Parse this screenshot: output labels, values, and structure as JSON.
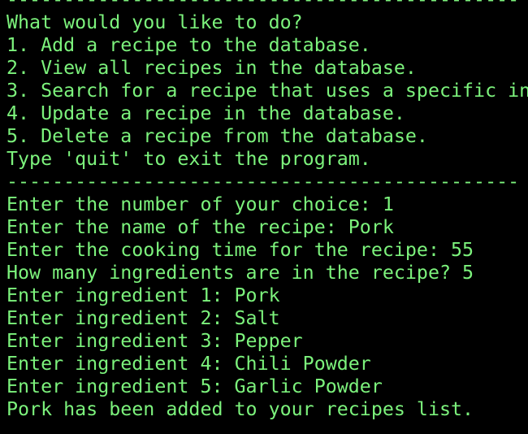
{
  "terminal": {
    "text_color": "#7CF27C",
    "background_color": "#000000",
    "separator_top": "---------------------------------------------",
    "menu": {
      "prompt": "What would you like to do?",
      "options": [
        "1. Add a recipe to the database.",
        "2. View all recipes in the database.",
        "3. Search for a recipe that uses a specific in",
        "4. Update a recipe in the database.",
        "5. Delete a recipe from the database."
      ],
      "quit_hint": "Type 'quit' to exit the program."
    },
    "separator_bottom": "---------------------------------------------",
    "session": [
      "Enter the number of your choice: 1",
      "Enter the name of the recipe: Pork",
      "Enter the cooking time for the recipe: 55",
      "How many ingredients are in the recipe? 5",
      "Enter ingredient 1: Pork",
      "Enter ingredient 2: Salt",
      "Enter ingredient 3: Pepper",
      "Enter ingredient 4: Chili Powder",
      "Enter ingredient 5: Garlic Powder",
      "Pork has been added to your recipes list."
    ]
  }
}
